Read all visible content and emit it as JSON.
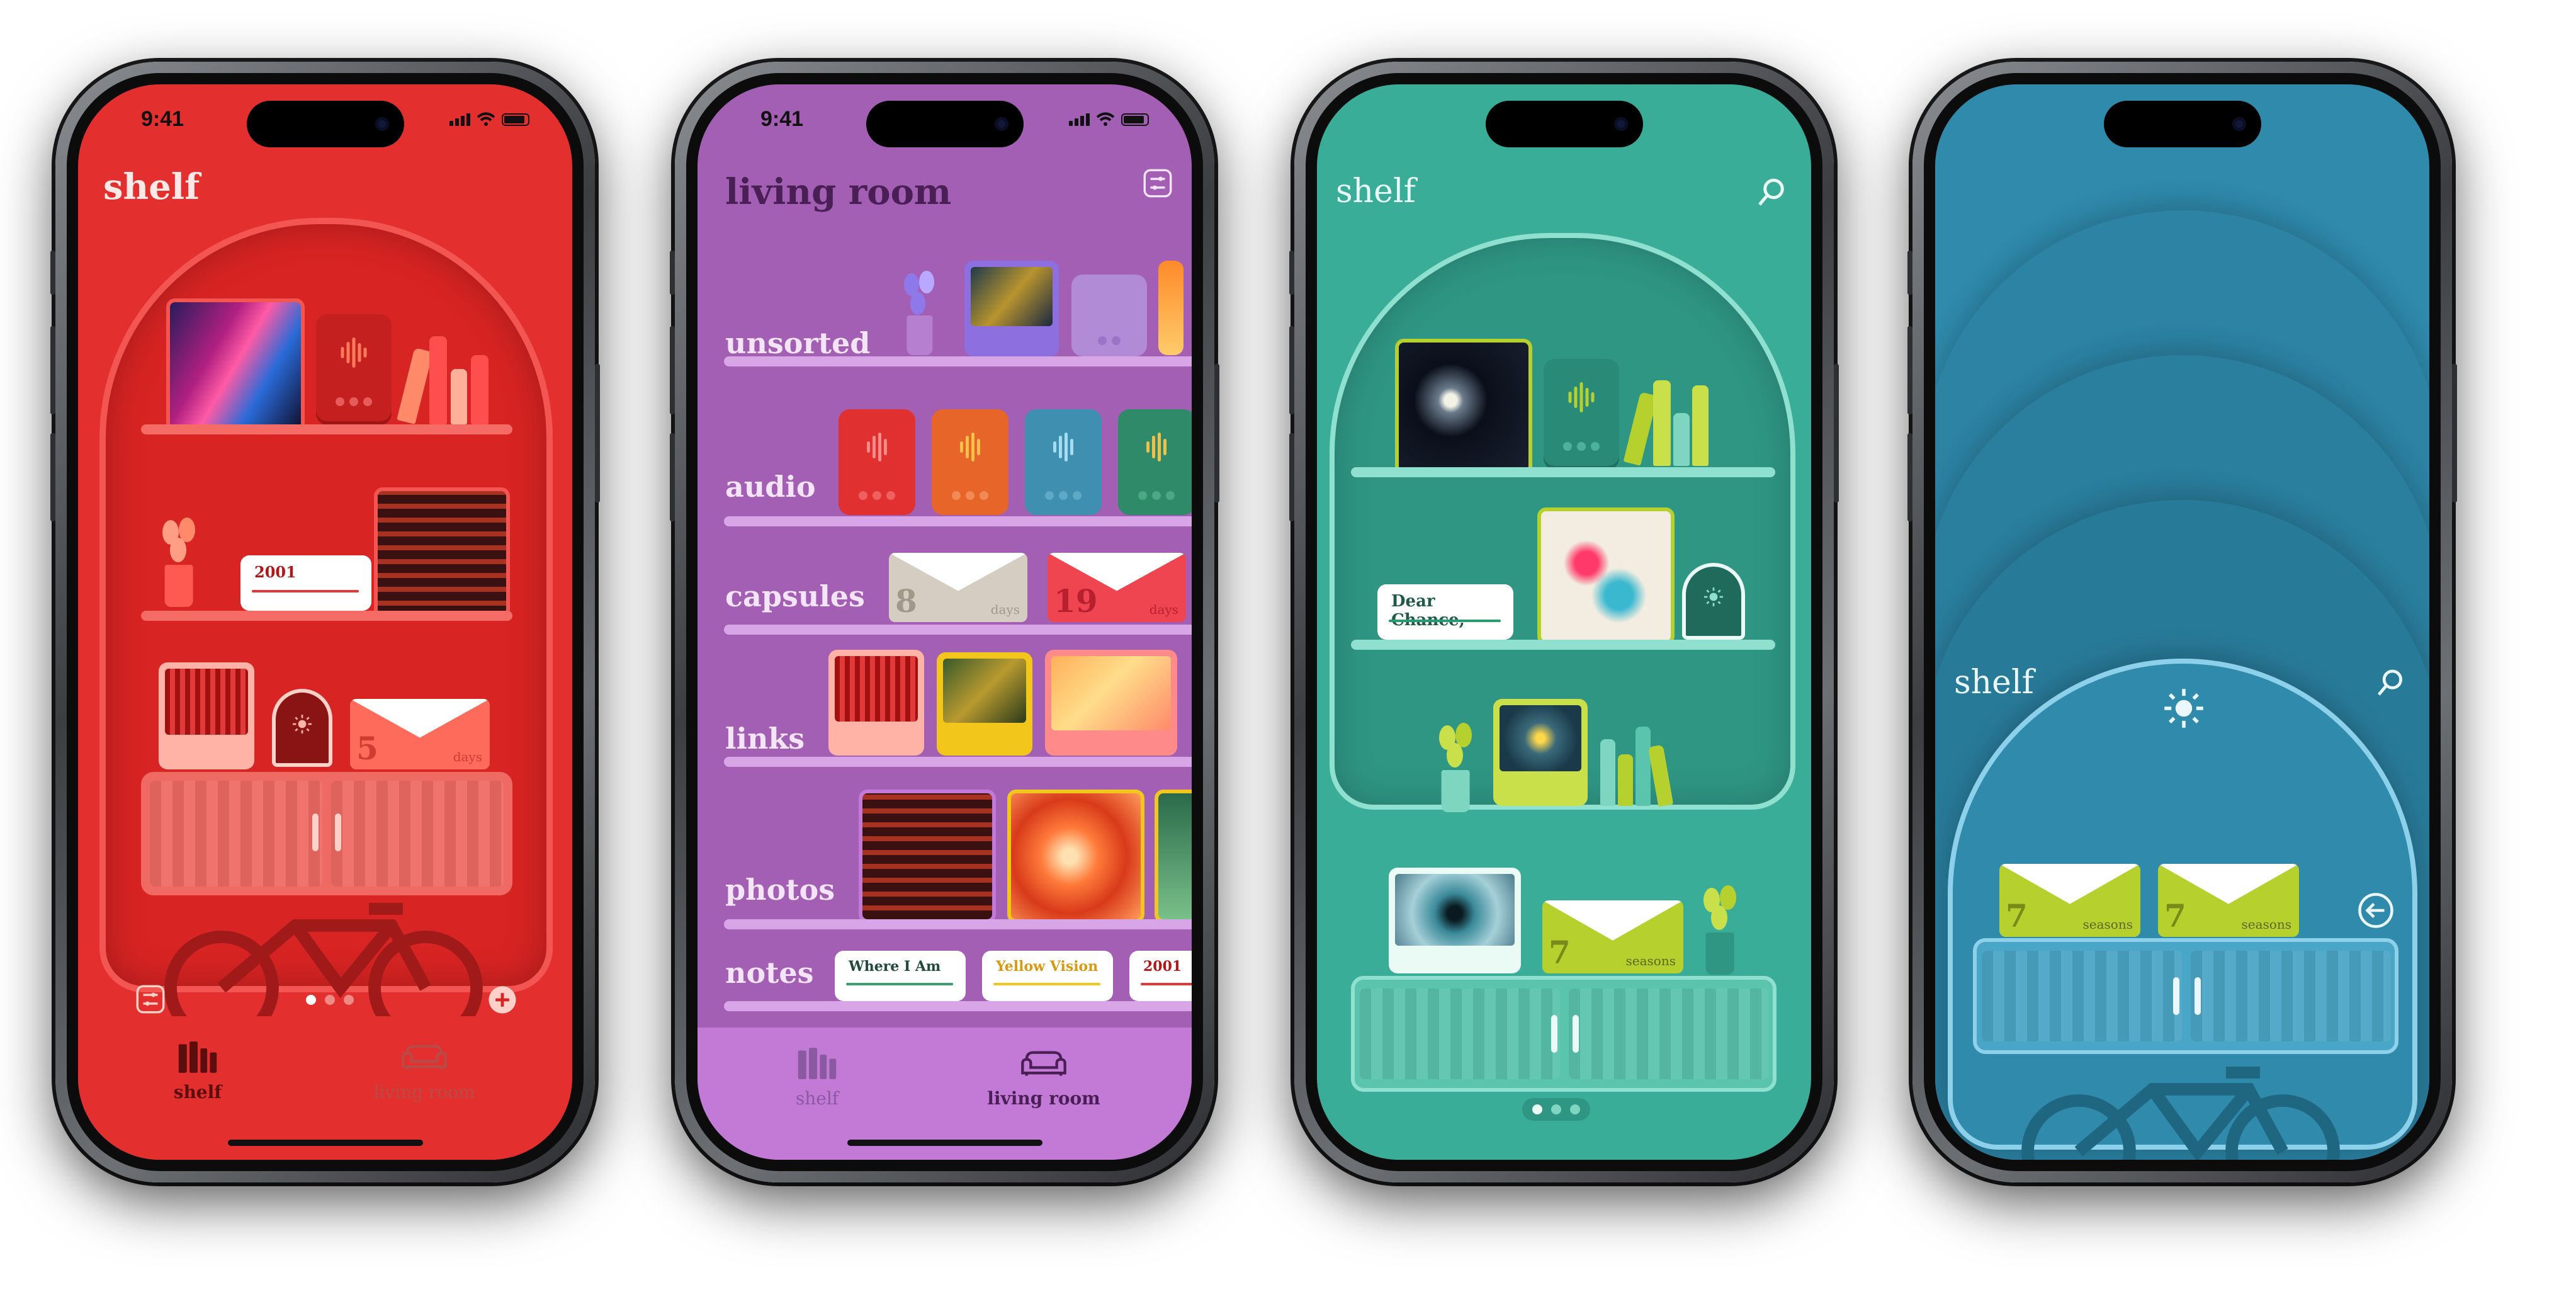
{
  "screens": [
    {
      "theme": "red",
      "status_time": "9:41",
      "title": "shelf",
      "calendar_card": {
        "label": "2001"
      },
      "capsule": {
        "number": "5",
        "unit": "days"
      },
      "tabs": [
        {
          "label": "shelf",
          "active": true
        },
        {
          "label": "living room",
          "active": false
        }
      ],
      "page_dots": {
        "count": 3,
        "current": 1
      },
      "colors": {
        "bg": "#e3302f",
        "accent": "#ff6b6b"
      }
    },
    {
      "theme": "purple",
      "status_time": "9:41",
      "title": "living room",
      "rows": [
        "unsorted",
        "audio",
        "capsules",
        "links",
        "photos",
        "notes"
      ],
      "capsules": [
        {
          "number": "8",
          "unit": "days"
        },
        {
          "number": "19",
          "unit": "days"
        }
      ],
      "notes": [
        "Where I Am",
        "Yellow Vision",
        "2001"
      ],
      "tabs": [
        {
          "label": "shelf",
          "active": false
        },
        {
          "label": "living room",
          "active": true
        }
      ],
      "colors": {
        "bg": "#a35fb3",
        "accent": "#c37ad6"
      }
    },
    {
      "theme": "teal",
      "title": "shelf",
      "note_card": {
        "label": "Dear Chance,"
      },
      "capsule": {
        "number": "7",
        "unit": "seasons"
      },
      "page_dots": {
        "count": 3,
        "current": 1
      },
      "colors": {
        "bg": "#39ad98",
        "accent": "#8fe0cf"
      }
    },
    {
      "theme": "blue",
      "title": "shelf",
      "capsules": [
        {
          "number": "7",
          "unit": "seasons"
        },
        {
          "number": "7",
          "unit": "seasons"
        }
      ],
      "colors": {
        "bg": "#2f8aac",
        "accent": "#8dd0ea"
      }
    }
  ],
  "icons": [
    "search-icon",
    "filter-icon",
    "add-icon",
    "sun-icon",
    "back-arrow-icon",
    "books-icon",
    "sofa-icon"
  ]
}
